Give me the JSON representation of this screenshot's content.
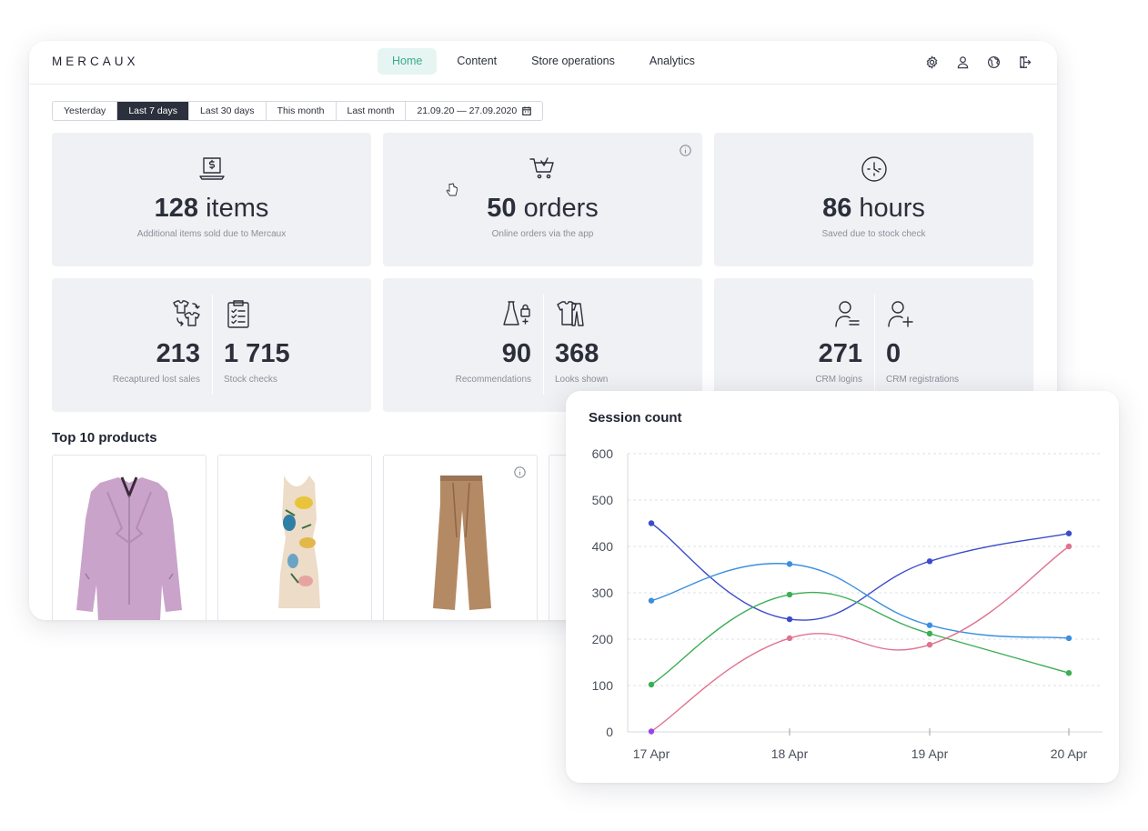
{
  "app": {
    "logo": "MERCAUX",
    "nav": [
      "Home",
      "Content",
      "Store operations",
      "Analytics"
    ],
    "nav_active": "Home",
    "top_icons": [
      "gear-icon",
      "user-icon",
      "globe-icon",
      "logout-icon"
    ]
  },
  "filters": {
    "items": [
      "Yesterday",
      "Last 7 days",
      "Last 30 days",
      "This month",
      "Last month"
    ],
    "active": "Last 7 days",
    "date_range": "21.09.20 — 27.09.2020"
  },
  "stats": {
    "items_sold": {
      "value": "128",
      "unit": "items",
      "label": "Additional items sold due to Mercaux",
      "icon": "laptop-sale-icon"
    },
    "orders": {
      "value": "50",
      "unit": "orders",
      "label": "Online orders via the app",
      "icon": "cart-icon"
    },
    "hours": {
      "value": "86",
      "unit": "hours",
      "label": "Saved due to stock check",
      "icon": "clock-icon"
    },
    "recaptured": {
      "value": "213",
      "label": "Recaptured lost sales",
      "icon": "shirts-exchange-icon"
    },
    "stock_checks": {
      "value": "1 715",
      "label": "Stock checks",
      "icon": "clipboard-icon"
    },
    "recommendations": {
      "value": "90",
      "label": "Recommendations",
      "icon": "dress-bag-icon"
    },
    "looks": {
      "value": "368",
      "label": "Looks shown",
      "icon": "outfit-icon"
    },
    "crm_logins": {
      "value": "271",
      "label": "CRM logins",
      "icon": "user-login-icon"
    },
    "crm_registrations": {
      "value": "0",
      "label": "CRM registrations",
      "icon": "user-add-icon"
    }
  },
  "top_products": {
    "title": "Top 10 products",
    "items": [
      "pink-jacket",
      "floral-dress",
      "wide-trousers"
    ]
  },
  "chart_data": {
    "type": "line",
    "title": "Session count",
    "categories": [
      "17 Apr",
      "18 Apr",
      "19 Apr",
      "20 Apr"
    ],
    "y_ticks": [
      "0",
      "100",
      "200",
      "300",
      "400",
      "500",
      "600"
    ],
    "ylim": [
      0,
      600
    ],
    "grid": true,
    "series": [
      {
        "color": "#3b4cca",
        "values": [
          450,
          243,
          368,
          428
        ]
      },
      {
        "color": "#3b8fe0",
        "values": [
          283,
          362,
          230,
          202
        ]
      },
      {
        "color": "#3cae55",
        "values": [
          102,
          296,
          212,
          127
        ]
      },
      {
        "color": "#e0738f",
        "values": [
          1,
          202,
          188,
          400
        ]
      }
    ],
    "start_point_color": "#9a46e6"
  }
}
